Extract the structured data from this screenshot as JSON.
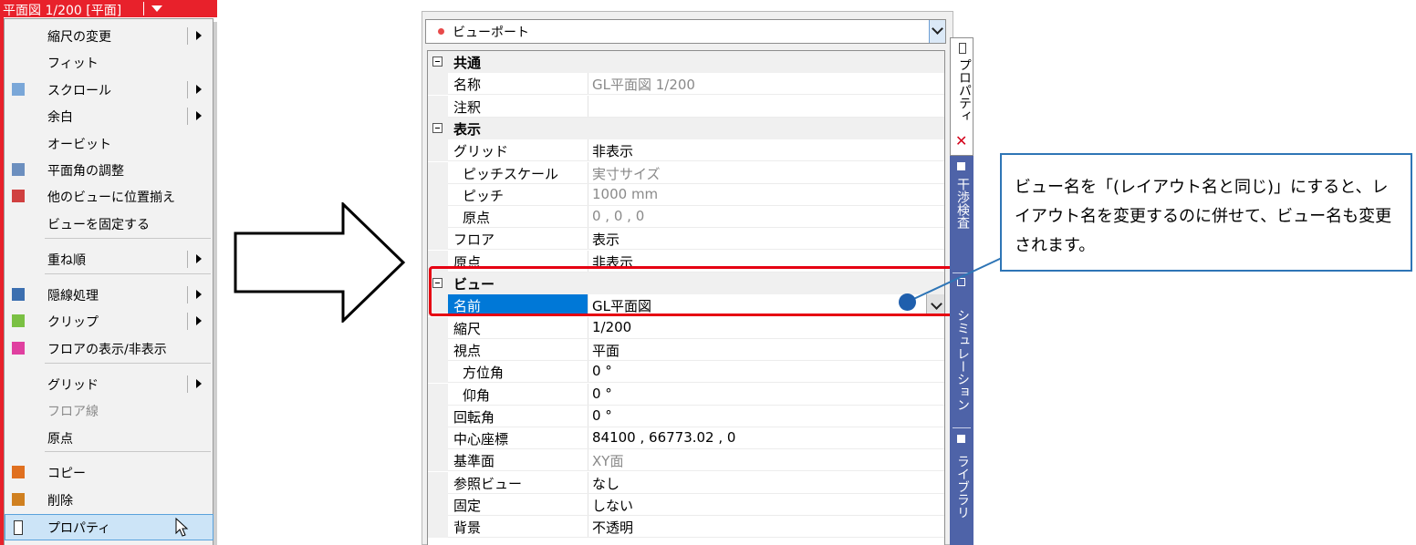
{
  "view_tab": {
    "label": "平面図 1/200 [平面]"
  },
  "context_menu": {
    "items": [
      {
        "label": "縮尺の変更",
        "icon": "",
        "submenu": true,
        "disabled": false
      },
      {
        "label": "フィット",
        "icon": "",
        "submenu": false,
        "disabled": false
      },
      {
        "label": "スクロール",
        "icon": "scroll-icon",
        "submenu": true,
        "disabled": false
      },
      {
        "label": "余白",
        "icon": "",
        "submenu": true,
        "disabled": false
      },
      {
        "label": "オービット",
        "icon": "",
        "submenu": false,
        "disabled": false
      },
      {
        "label": "平面角の調整",
        "icon": "plane-angle-icon",
        "submenu": false,
        "disabled": false
      },
      {
        "label": "他のビューに位置揃え",
        "icon": "align-views-icon",
        "submenu": false,
        "disabled": false
      },
      {
        "label": "ビューを固定する",
        "icon": "",
        "submenu": false,
        "disabled": false
      },
      {
        "label": "重ね順",
        "icon": "",
        "submenu": true,
        "disabled": false
      },
      {
        "label": "隠線処理",
        "icon": "hidden-line-icon",
        "submenu": true,
        "disabled": false
      },
      {
        "label": "クリップ",
        "icon": "clip-icon",
        "submenu": true,
        "disabled": false
      },
      {
        "label": "フロアの表示/非表示",
        "icon": "floor-visibility-icon",
        "submenu": false,
        "disabled": false
      },
      {
        "label": "グリッド",
        "icon": "",
        "submenu": true,
        "disabled": false
      },
      {
        "label": "フロア線",
        "icon": "",
        "submenu": false,
        "disabled": true
      },
      {
        "label": "原点",
        "icon": "",
        "submenu": false,
        "disabled": false
      },
      {
        "label": "コピー",
        "icon": "copy-icon",
        "submenu": false,
        "disabled": false
      },
      {
        "label": "削除",
        "icon": "delete-icon",
        "submenu": false,
        "disabled": false
      },
      {
        "label": "プロパティ",
        "icon": "properties-icon",
        "submenu": false,
        "disabled": false,
        "highlighted": true
      }
    ]
  },
  "properties": {
    "object_type": "ビューポート",
    "rows": [
      {
        "kind": "category",
        "name": "共通"
      },
      {
        "kind": "prop",
        "name": "名称",
        "value": "GL平面図 1/200",
        "indent": 1,
        "gray": true
      },
      {
        "kind": "prop",
        "name": "注釈",
        "value": "",
        "indent": 1
      },
      {
        "kind": "category",
        "name": "表示"
      },
      {
        "kind": "prop",
        "name": "グリッド",
        "value": "非表示",
        "indent": 1
      },
      {
        "kind": "prop",
        "name": "ピッチスケール",
        "value": "実寸サイズ",
        "indent": 2,
        "gray": true
      },
      {
        "kind": "prop",
        "name": "ピッチ",
        "value": "1000 mm",
        "indent": 2,
        "gray": true
      },
      {
        "kind": "prop",
        "name": "原点",
        "value": "0 , 0 , 0",
        "indent": 2,
        "gray": true
      },
      {
        "kind": "prop",
        "name": "フロア",
        "value": "表示",
        "indent": 1
      },
      {
        "kind": "prop",
        "name": "原点",
        "value": "非表示",
        "indent": 1
      },
      {
        "kind": "category",
        "name": "ビュー"
      },
      {
        "kind": "prop",
        "name": "名前",
        "value": "GL平面図",
        "indent": 1,
        "selected": true
      },
      {
        "kind": "prop",
        "name": "縮尺",
        "value": "1/200",
        "indent": 1
      },
      {
        "kind": "prop",
        "name": "視点",
        "value": "平面",
        "indent": 1
      },
      {
        "kind": "prop",
        "name": "方位角",
        "value": "0 °",
        "indent": 2
      },
      {
        "kind": "prop",
        "name": "仰角",
        "value": "0 °",
        "indent": 2
      },
      {
        "kind": "prop",
        "name": "回転角",
        "value": "0 °",
        "indent": 1
      },
      {
        "kind": "prop",
        "name": "中心座標",
        "value": "84100 , 66773.02 , 0",
        "indent": 1
      },
      {
        "kind": "prop",
        "name": "基準面",
        "value": "XY面",
        "indent": 1,
        "gray": true
      },
      {
        "kind": "prop",
        "name": "参照ビュー",
        "value": "なし",
        "indent": 1
      },
      {
        "kind": "prop",
        "name": "固定",
        "value": "しない",
        "indent": 1
      },
      {
        "kind": "prop",
        "name": "背景",
        "value": "不透明",
        "indent": 1
      }
    ],
    "side_tabs": {
      "properties": "プロパティ",
      "interference": "干渉検査",
      "simulation": "シミュレーション",
      "library": "ライブラリ"
    }
  },
  "callout": {
    "text": "ビュー名を「(レイアウト名と同じ)」にすると、レイアウト名を変更するのに併せて、ビュー名も変更されます。"
  },
  "colors": {
    "accent_red": "#e8212b",
    "selection_blue": "#0078d7",
    "side_tab_blue": "#4e63a8",
    "callout_border": "#2e75b6"
  }
}
